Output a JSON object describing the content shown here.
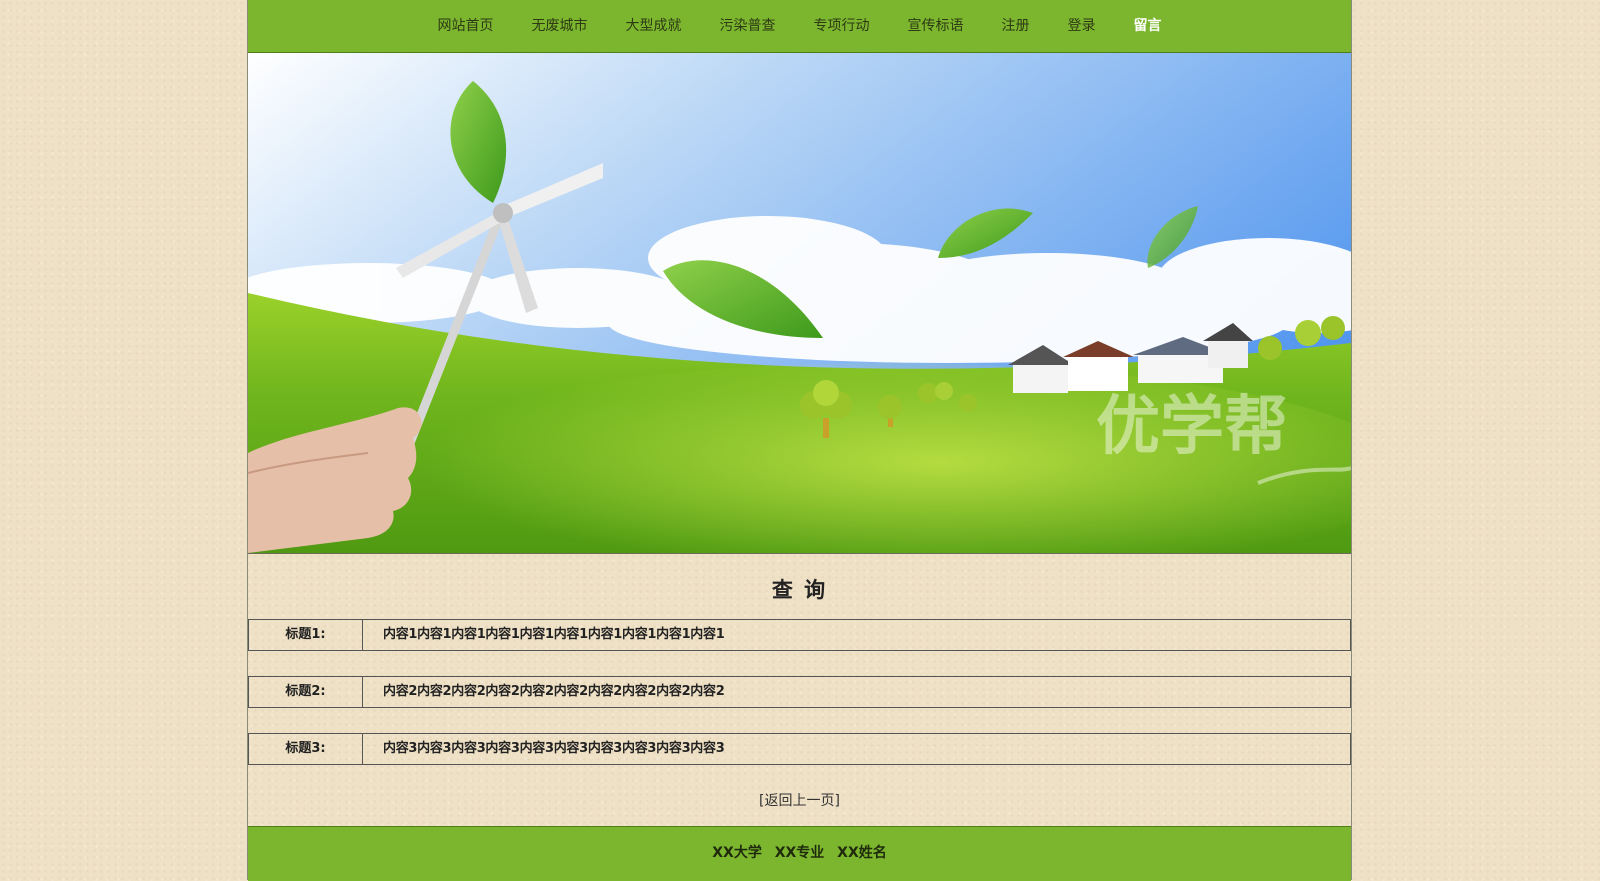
{
  "nav": {
    "items": [
      {
        "label": "网站首页"
      },
      {
        "label": "无废城市"
      },
      {
        "label": "大型成就"
      },
      {
        "label": "污染普查"
      },
      {
        "label": "专项行动"
      },
      {
        "label": "宣传标语"
      },
      {
        "label": "注册"
      },
      {
        "label": "登录"
      },
      {
        "label": "留言"
      }
    ],
    "active_index": 8
  },
  "banner": {
    "watermark": "优学帮"
  },
  "main": {
    "title": "查 询",
    "rows": [
      {
        "label": "标题1:",
        "value": "内容1内容1内容1内容1内容1内容1内容1内容1内容1内容1"
      },
      {
        "label": "标题2:",
        "value": "内容2内容2内容2内容2内容2内容2内容2内容2内容2内容2"
      },
      {
        "label": "标题3:",
        "value": "内容3内容3内容3内容3内容3内容3内容3内容3内容3内容3"
      }
    ],
    "back_link": "[返回上一页]"
  },
  "footer": {
    "school": "XX大学",
    "major": "XX专业",
    "name": "XX姓名"
  },
  "colors": {
    "nav_green": "#7bb62e",
    "page_bg": "#efe1c6"
  }
}
